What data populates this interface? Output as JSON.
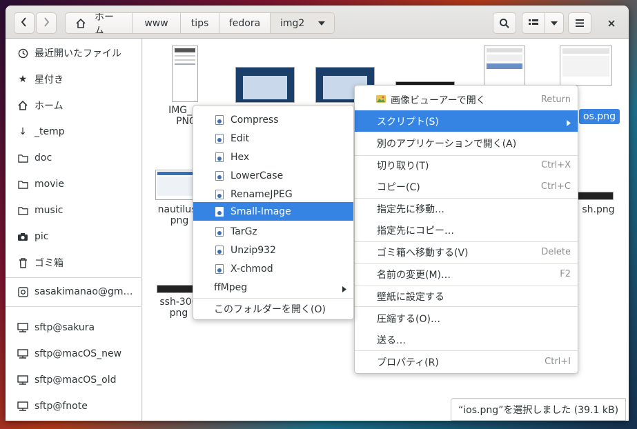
{
  "headerbar": {
    "path": [
      {
        "label": "ホーム",
        "icon": "home-icon"
      },
      {
        "label": "www"
      },
      {
        "label": "tips"
      },
      {
        "label": "fedora"
      },
      {
        "label": "img2"
      }
    ]
  },
  "sidebar": {
    "items": [
      {
        "label": "最近開いたファイル",
        "icon": "clock-icon"
      },
      {
        "label": "星付き",
        "icon": "star-icon"
      },
      {
        "label": "ホーム",
        "icon": "home-icon"
      },
      {
        "label": "_temp",
        "icon": "arrow-down-icon"
      },
      {
        "label": "doc",
        "icon": "folder-icon"
      },
      {
        "label": "movie",
        "icon": "folder-icon"
      },
      {
        "label": "music",
        "icon": "folder-icon"
      },
      {
        "label": "pic",
        "icon": "camera-icon"
      },
      {
        "label": "ゴミ箱",
        "icon": "trash-icon"
      },
      {
        "label": "sasakimanao@gm…",
        "icon": "account-icon"
      },
      {
        "label": "sftp@sakura",
        "icon": "network-icon"
      },
      {
        "label": "sftp@macOS_new",
        "icon": "network-icon"
      },
      {
        "label": "sftp@macOS_old",
        "icon": "network-icon"
      },
      {
        "label": "sftp@fnote",
        "icon": "network-icon"
      }
    ]
  },
  "files": [
    {
      "line1": "IMG_02",
      "line2": "PNG"
    },
    {
      "line1": "nautilus_",
      "line2": "png"
    },
    {
      "line1": "ssh-300",
      "line2": "png"
    },
    {
      "line1": "os.png"
    },
    {
      "line1": "sh.png"
    }
  ],
  "context_menu": {
    "items": [
      {
        "label": "画像ビューアーで開く",
        "accel": "Return"
      },
      {
        "label": "スクリプト(S)"
      },
      {
        "label": "別のアプリケーションで開く(A)"
      },
      {
        "label": "切り取り(T)",
        "accel": "Ctrl+X"
      },
      {
        "label": "コピー(C)",
        "accel": "Ctrl+C"
      },
      {
        "label": "指定先に移動…"
      },
      {
        "label": "指定先にコピー…"
      },
      {
        "label": "ゴミ箱へ移動する(V)",
        "accel": "Delete"
      },
      {
        "label": "名前の変更(M)…",
        "accel": "F2"
      },
      {
        "label": "壁紙に設定する"
      },
      {
        "label": "圧縮する(O)…"
      },
      {
        "label": "送る…"
      },
      {
        "label": "プロパティ(R)",
        "accel": "Ctrl+I"
      }
    ]
  },
  "scripts_menu": {
    "items": [
      {
        "label": "Compress"
      },
      {
        "label": "Edit"
      },
      {
        "label": "Hex"
      },
      {
        "label": "LowerCase"
      },
      {
        "label": "RenameJPEG"
      },
      {
        "label": "Small-Image"
      },
      {
        "label": "TarGz"
      },
      {
        "label": "Unzip932"
      },
      {
        "label": "X-chmod"
      },
      {
        "label": "ffMpeg"
      },
      {
        "label": "このフォルダーを開く(O)"
      }
    ]
  },
  "status": {
    "text": "“ios.png”を選択しました (39.1 kB)"
  },
  "colors": {
    "accent": "#3584e4"
  }
}
